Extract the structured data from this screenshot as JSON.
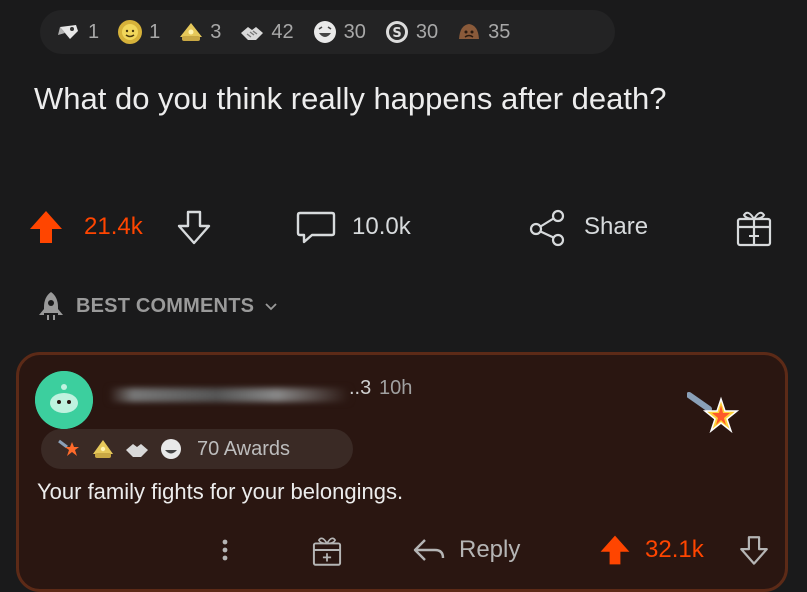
{
  "post_awards": [
    {
      "icon": "rocket-like-icon",
      "count": "1"
    },
    {
      "icon": "sun-face-icon",
      "count": "1"
    },
    {
      "icon": "wholesome-helmet-icon",
      "count": "3"
    },
    {
      "icon": "handshake-icon",
      "count": "42"
    },
    {
      "icon": "laughing-face-icon",
      "count": "30"
    },
    {
      "icon": "silver-coin-icon",
      "count": "30"
    },
    {
      "icon": "sad-face-icon",
      "count": "35"
    }
  ],
  "post": {
    "title": "What do you think really happens after death?",
    "upvotes": "21.4k",
    "comments": "10.0k",
    "share_label": "Share"
  },
  "sort": {
    "label": "BEST COMMENTS"
  },
  "comment": {
    "user_suffix": "..3",
    "time": "10h",
    "awards_label": "70 Awards",
    "body": "Your family fights for your belongings.",
    "reply_label": "Reply",
    "upvotes": "32.1k"
  },
  "colors": {
    "upvote": "#ff4500",
    "background": "#1a1a1b",
    "comment_border": "#5c2a17",
    "avatar": "#3ccf9e"
  }
}
